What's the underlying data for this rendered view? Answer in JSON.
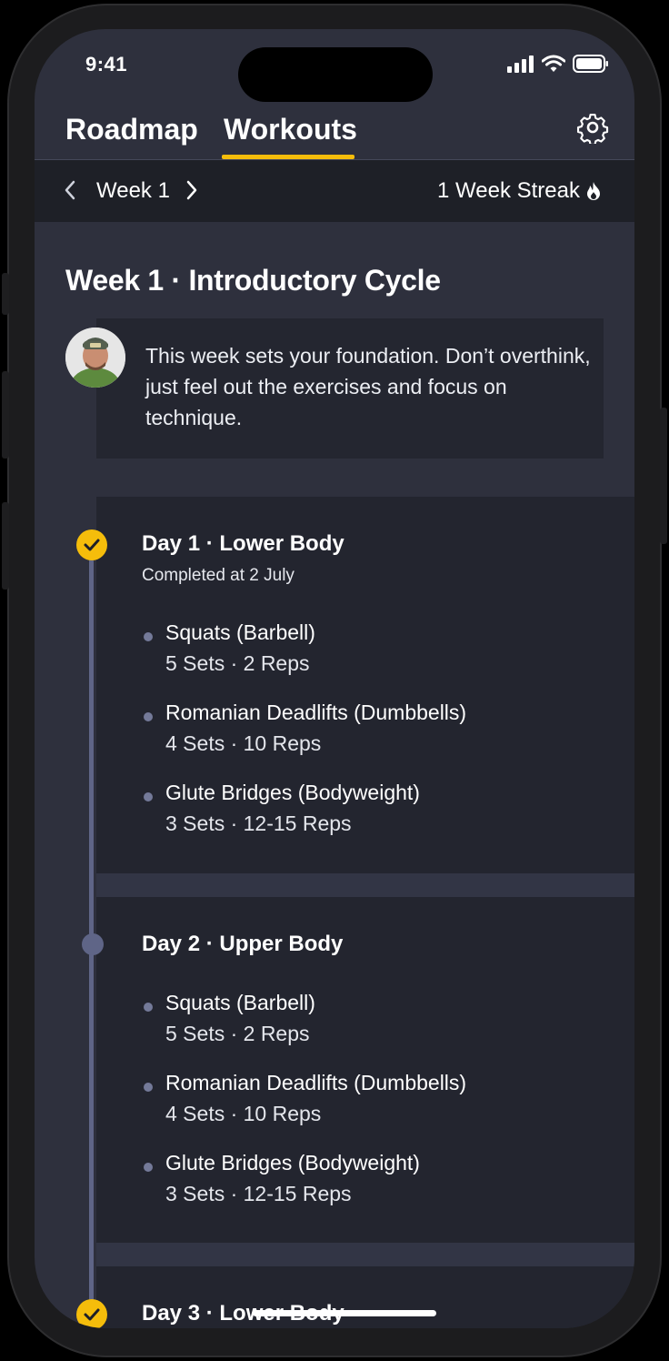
{
  "status": {
    "time": "9:41"
  },
  "nav": {
    "tabs": [
      {
        "label": "Roadmap",
        "active": false
      },
      {
        "label": "Workouts",
        "active": true
      }
    ],
    "settings_icon": "gear-icon"
  },
  "week_bar": {
    "label": "Week 1",
    "streak": "1 Week Streak"
  },
  "week": {
    "title": "Week 1 · Introductory Cycle",
    "coach_message": "This week sets your foundation. Don’t overthink, just feel out the exercises and focus on technique."
  },
  "days": [
    {
      "title": "Day 1 · Lower Body",
      "status": "Completed at 2 July",
      "completed": true,
      "exercises": [
        {
          "name": "Squats (Barbell)",
          "meta": "5 Sets · 2 Reps"
        },
        {
          "name": "Romanian Deadlifts (Dumbbells)",
          "meta": "4 Sets · 10 Reps"
        },
        {
          "name": "Glute Bridges (Bodyweight)",
          "meta": "3 Sets · 12-15 Reps"
        }
      ]
    },
    {
      "title": "Day 2 · Upper Body",
      "completed": false,
      "exercises": [
        {
          "name": "Squats (Barbell)",
          "meta": "5 Sets · 2 Reps"
        },
        {
          "name": "Romanian Deadlifts (Dumbbells)",
          "meta": "4 Sets · 10 Reps"
        },
        {
          "name": "Glute Bridges (Bodyweight)",
          "meta": "3 Sets · 12-15 Reps"
        }
      ]
    },
    {
      "title": "Day 3 · Lower Body",
      "completed": true
    }
  ],
  "colors": {
    "accent": "#f5bd0b",
    "background": "#2e303d",
    "card": "#23252f",
    "timeline": "#5f6587"
  }
}
